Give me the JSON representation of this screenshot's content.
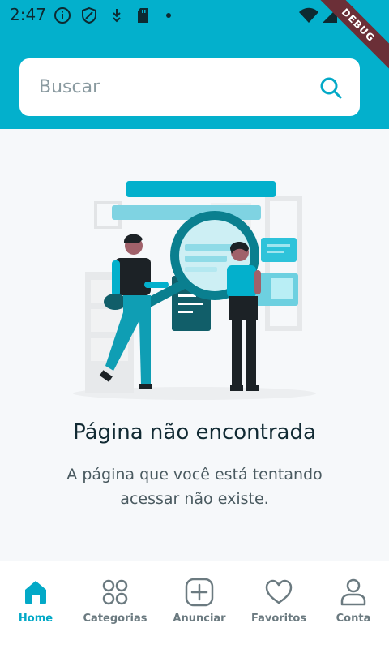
{
  "status_bar": {
    "time": "2:47",
    "icons": [
      "info-icon",
      "shield-icon",
      "download-icon",
      "sd-card-icon",
      "dot-icon",
      "wifi-icon",
      "signal-icon",
      "battery-icon"
    ],
    "debug_banner": "DEBUG"
  },
  "search": {
    "placeholder": "Buscar"
  },
  "empty_state": {
    "title": "Página não encontrada",
    "message": "A página que você está tentando acessar não existe."
  },
  "bottom_nav": {
    "items": [
      {
        "label": "Home",
        "icon": "home-icon",
        "active": true
      },
      {
        "label": "Categorias",
        "icon": "categories-icon",
        "active": false
      },
      {
        "label": "Anunciar",
        "icon": "add-icon",
        "active": false
      },
      {
        "label": "Favoritos",
        "icon": "heart-icon",
        "active": false
      },
      {
        "label": "Conta",
        "icon": "account-icon",
        "active": false
      }
    ]
  },
  "colors": {
    "accent": "#03b0cc",
    "active_nav": "#03a9c7",
    "inactive_nav": "#6b7a80",
    "debug_banner": "#6b2f37"
  }
}
